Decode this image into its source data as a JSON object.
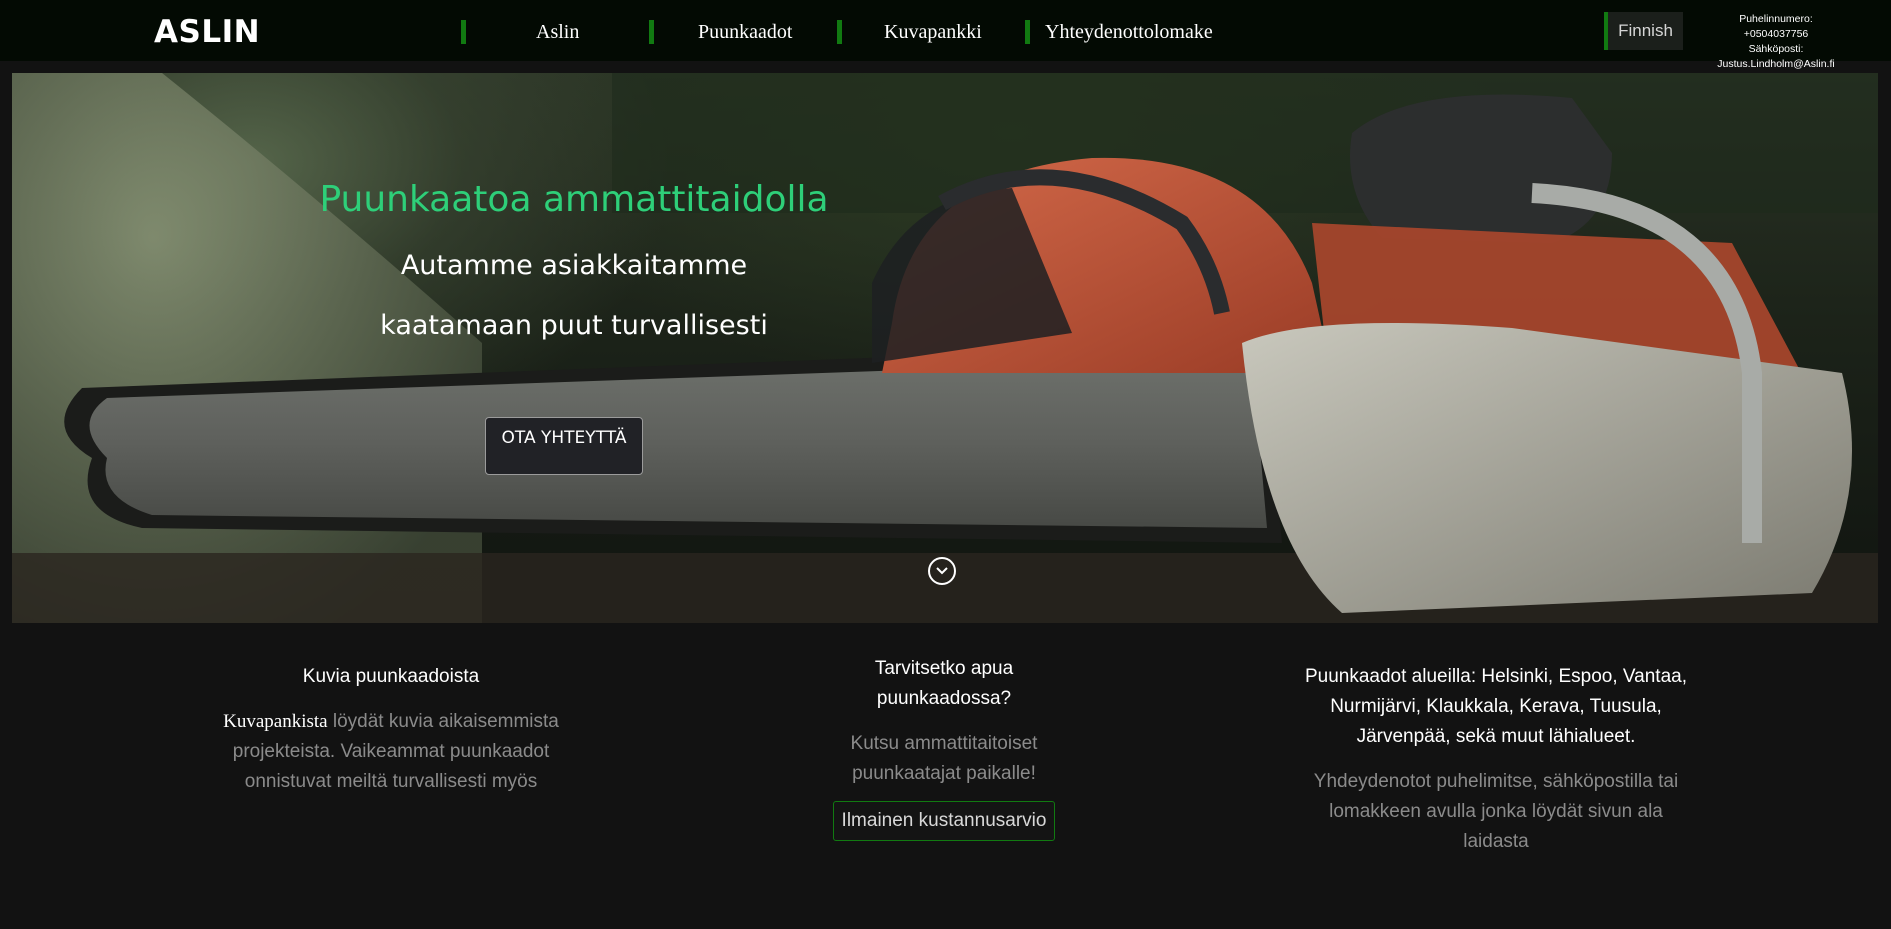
{
  "brand": "ASLIN",
  "nav": {
    "items": [
      {
        "label": "Aslin"
      },
      {
        "label": "Puunkaadot"
      },
      {
        "label": "Kuvapankki"
      },
      {
        "label": "Yhteydenottolomake"
      }
    ],
    "language": "Finnish",
    "contact": {
      "phone_label": "Puhelinnumero:",
      "phone": "+0504037756",
      "email_line": "Sähköposti: Justus.Lindholm@Aslin.fi"
    }
  },
  "hero": {
    "title": "Puunkaatoa ammattitaidolla",
    "subtitle_1": "Autamme asiakkaitamme",
    "subtitle_2": "kaatamaan puut turvallisesti",
    "cta": "OTA YHTEYTTÄ"
  },
  "columns": {
    "gallery": {
      "heading": "Kuvia puunkaadoista",
      "link_word": "Kuvapankista",
      "text_1": " löydät kuvia aikaisemmista",
      "text_2": "projekteista. Vaikeammat puunkaadot",
      "text_3": "onnistuvat meiltä turvallisesti myös"
    },
    "help": {
      "heading_1": "Tarvitsetko apua",
      "heading_2": "puunkaadossa?",
      "text_1": "Kutsu ammattitaitoiset",
      "text_2": "puunkaatajat paikalle!",
      "button": "Ilmainen kustannusarvio"
    },
    "areas": {
      "heading_1": "Puunkaadot alueilla: Helsinki, Espoo, Vantaa,",
      "heading_2": "Nurmijärvi, Klaukkala, Kerava, Tuusula,",
      "heading_3": "Järvenpää, sekä muut lähialueet.",
      "text_1": "Yhdeydenotot puhelimitse, sähköpostilla tai",
      "text_2": "lomakkeen avulla jonka löydät sivun ala",
      "text_3": "laidasta"
    }
  },
  "colors": {
    "accent_green": "#117a11",
    "hero_title": "#2ecf79",
    "background": "#121212"
  },
  "icons": {
    "scroll": "chevron-down-circle-icon"
  }
}
